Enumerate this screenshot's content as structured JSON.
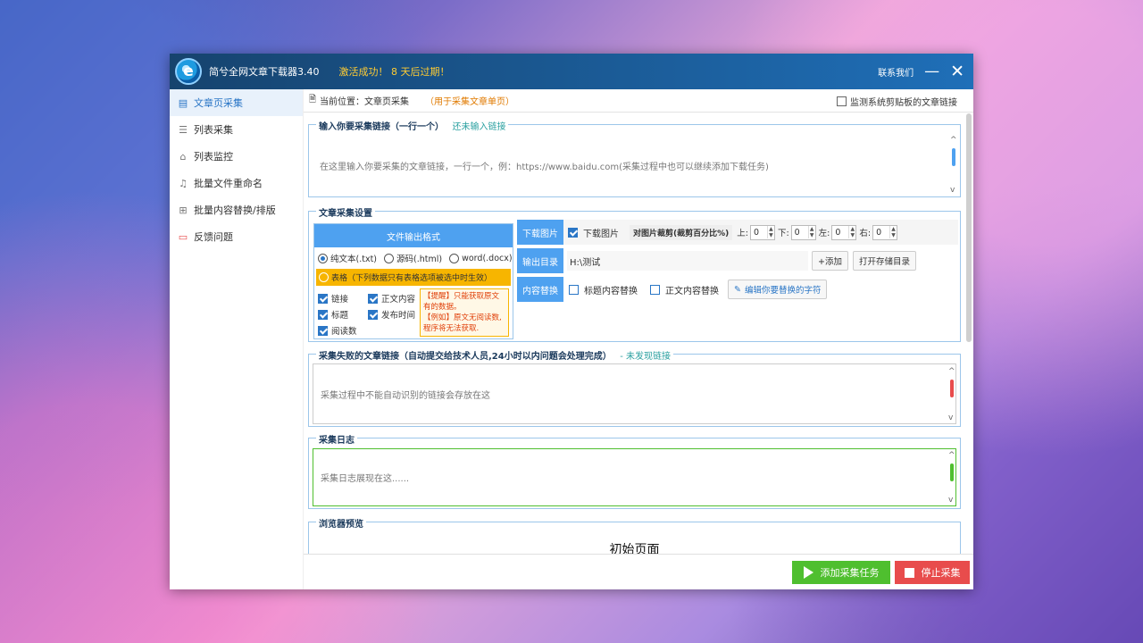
{
  "app": {
    "title": "简兮全网文章下载器3.40",
    "activation": "激活成功！ 8 天后过期！",
    "contact": "联系我们",
    "minimize": "—",
    "close": "✕"
  },
  "sidebar": {
    "items": [
      {
        "label": "文章页采集",
        "icon": "document-icon",
        "active": true
      },
      {
        "label": "列表采集",
        "icon": "list-icon"
      },
      {
        "label": "列表监控",
        "icon": "monitor-icon"
      },
      {
        "label": "批量文件重命名",
        "icon": "rename-icon"
      },
      {
        "label": "批量内容替换/排版",
        "icon": "replace-icon"
      },
      {
        "label": "反馈问题",
        "icon": "feedback-icon"
      }
    ]
  },
  "location": {
    "prefix": "当前位置：",
    "page": "文章页采集",
    "hint": "（用于采集文章单页）",
    "monitor_label": "监测系统剪贴板的文章链接"
  },
  "input_links": {
    "title": "输入你要采集链接（一行一个）",
    "status": "还未输入链接",
    "placeholder": "在这里输入你要采集的文章链接，一行一个，例：https://www.baidu.com(采集过程中也可以继续添加下载任务)"
  },
  "settings": {
    "title": "文章采集设置",
    "format_header": "文件输出格式",
    "formats": [
      {
        "label": "纯文本(.txt)",
        "selected": true
      },
      {
        "label": "源码(.html)",
        "selected": false
      },
      {
        "label": "word(.docx)",
        "selected": false
      }
    ],
    "table_option": "表格（下列数据只有表格选项被选中时生效）",
    "checks": [
      {
        "label": "链接",
        "checked": true
      },
      {
        "label": "正文内容",
        "checked": true
      },
      {
        "label": "标题",
        "checked": true
      },
      {
        "label": "发布时间",
        "checked": true
      },
      {
        "label": "阅读数",
        "checked": true
      }
    ],
    "warning_lines": [
      "【提醒】只能获取原文有的数据。",
      "【例如】原文无阅读数,程序将无法获取."
    ],
    "download_images": {
      "label": "下载图片",
      "checkbox": "下载图片",
      "crop_label": "对图片裁剪(裁剪百分比%)",
      "sides": [
        {
          "label": "上:",
          "value": "0"
        },
        {
          "label": "下:",
          "value": "0"
        },
        {
          "label": "左:",
          "value": "0"
        },
        {
          "label": "右:",
          "value": "0"
        }
      ]
    },
    "output_dir": {
      "label": "输出目录",
      "value": "H:\\测试",
      "add_button": "+添加",
      "open_button": "打开存储目录"
    },
    "replace": {
      "label": "内容替换",
      "title_replace": "标题内容替换",
      "body_replace": "正文内容替换",
      "edit_button": "编辑你要替换的字符"
    }
  },
  "failed": {
    "title": "采集失败的文章链接（自动提交给技术人员,24小时以内问题会处理完成）",
    "status": "- 未发现链接",
    "placeholder": "采集过程中不能自动识别的链接会存放在这"
  },
  "log": {
    "title": "采集日志",
    "placeholder": "采集日志展现在这......"
  },
  "preview": {
    "title": "浏览器预览",
    "page": "初始页面"
  },
  "actions": {
    "add": "添加采集任务",
    "stop": "停止采集"
  },
  "colors": {
    "accent": "#4ea1f0",
    "titlebar": "#1f6fb8",
    "warning": "#f7b500",
    "add_button": "#4fbf2f",
    "stop_button": "#e84c4c"
  }
}
